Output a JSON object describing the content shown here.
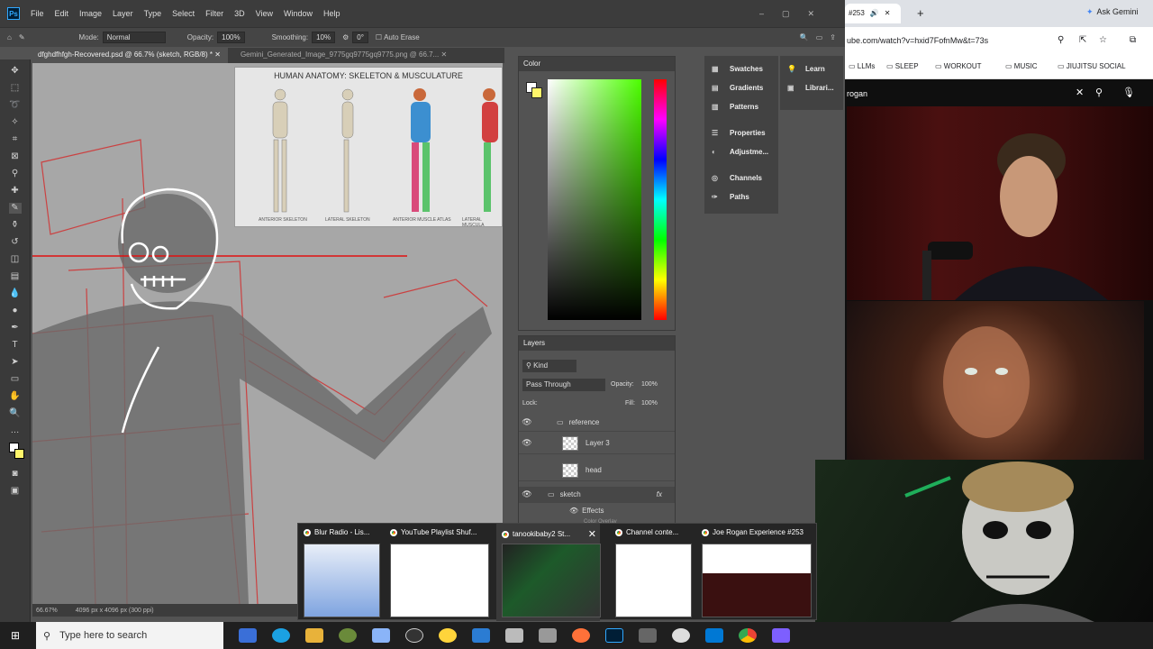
{
  "photoshop": {
    "logo": "Ps",
    "menu": [
      "File",
      "Edit",
      "Image",
      "Layer",
      "Type",
      "Select",
      "Filter",
      "3D",
      "View",
      "Window",
      "Help"
    ],
    "options": {
      "mode_label": "Mode:",
      "mode_value": "Normal",
      "opacity_label": "Opacity:",
      "opacity_value": "100%",
      "smoothing_label": "Smoothing:",
      "smoothing_value": "10%",
      "angle_value": "0°",
      "auto_erase_label": "Auto Erase"
    },
    "doc_tabs": [
      "dfghdfhfgh-Recovered.psd @ 66.7% (sketch, RGB/8) *",
      "Gemini_Generated_Image_9775gq9775gq9775.png @ 66.7..."
    ],
    "reference": {
      "title": "HUMAN ANATOMY: SKELETON & MUSCULATURE",
      "captions": [
        "ANTERIOR SKELETON",
        "LATERAL SKELETON",
        "ANTERIOR MUSCLE ATLAS",
        "LATERAL MUSCULA"
      ]
    },
    "status": {
      "zoom": "66.67%",
      "size": "4096 px x 4096 px (300 ppi)"
    },
    "color_panel": {
      "title": "Color"
    },
    "layers_panel": {
      "title": "Layers",
      "filter_kind": "Kind",
      "blend_mode": "Pass Through",
      "opacity_label": "Opacity:",
      "opacity_value": "100%",
      "lock_label": "Lock:",
      "fill_label": "Fill:",
      "fill_value": "100%",
      "layers": [
        {
          "name": "reference",
          "type": "group"
        },
        {
          "name": "Layer 3",
          "type": "layer"
        },
        {
          "name": "head",
          "type": "layer"
        },
        {
          "name": "sketch",
          "type": "group"
        },
        {
          "name": "Effects",
          "type": "effects"
        },
        {
          "name": "Color Overlay",
          "type": "effect"
        }
      ]
    },
    "dock": [
      "Swatches",
      "Gradients",
      "Patterns",
      "Properties",
      "Adjustme...",
      "Channels",
      "Paths"
    ],
    "dock2": [
      "Learn",
      "Librari..."
    ]
  },
  "browser": {
    "tab_title": "#253",
    "new_tab": "+",
    "gemini": "Ask Gemini",
    "address": "ube.com/watch?v=hxid7FofnMw&t=73s",
    "bookmarks": [
      "LLMs",
      "SLEEP",
      "WORKOUT",
      "MUSIC",
      "JIUJITSU SOCIAL"
    ],
    "search_value": "rogan"
  },
  "alt_tab": [
    "Blur Radio - Lis...",
    "YouTube Playlist Shuf...",
    "tanookibaby2 St...",
    "Channel conte...",
    "Joe Rogan Experience #253"
  ],
  "taskbar": {
    "search_placeholder": "Type here to search"
  }
}
